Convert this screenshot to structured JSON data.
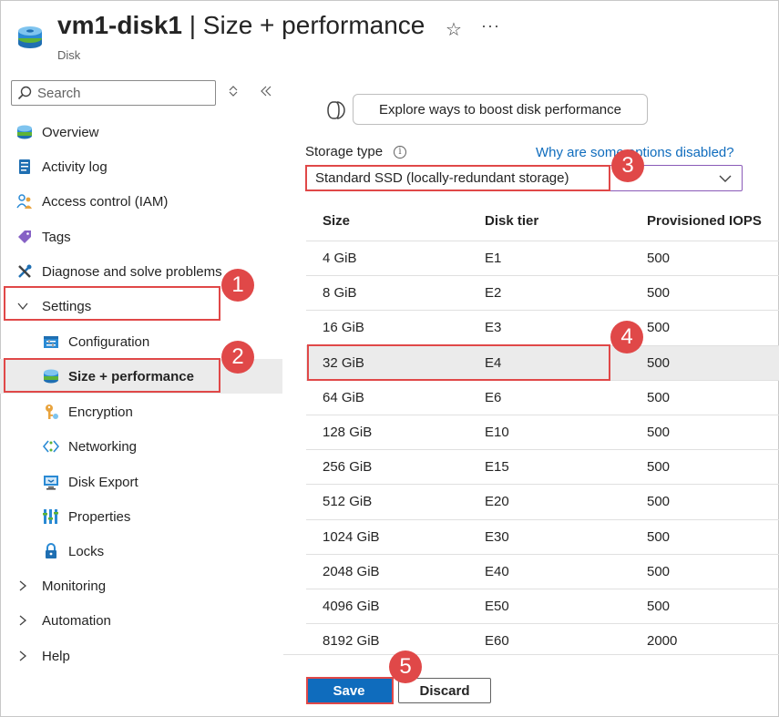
{
  "header": {
    "resource_name": "vm1-disk1",
    "page_title": " | Size + performance",
    "resource_type": "Disk",
    "star_glyph": "☆",
    "more_glyph": "···"
  },
  "sidebar": {
    "search_placeholder": "Search",
    "items": [
      {
        "label": "Overview",
        "icon": "disk-icon"
      },
      {
        "label": "Activity log",
        "icon": "activity-log-icon"
      },
      {
        "label": "Access control (IAM)",
        "icon": "people-icon"
      },
      {
        "label": "Tags",
        "icon": "tag-icon"
      },
      {
        "label": "Diagnose and solve problems",
        "icon": "wrench-icon"
      },
      {
        "label": "Settings",
        "icon": "chevron-down-icon",
        "expanded": true
      },
      {
        "label": "Configuration",
        "icon": "configuration-icon"
      },
      {
        "label": "Size + performance",
        "icon": "disk-icon",
        "active": true
      },
      {
        "label": "Encryption",
        "icon": "key-icon"
      },
      {
        "label": "Networking",
        "icon": "networking-icon"
      },
      {
        "label": "Disk Export",
        "icon": "export-icon"
      },
      {
        "label": "Properties",
        "icon": "properties-icon"
      },
      {
        "label": "Locks",
        "icon": "lock-icon"
      },
      {
        "label": "Monitoring",
        "icon": "chevron-right-icon"
      },
      {
        "label": "Automation",
        "icon": "chevron-right-icon"
      },
      {
        "label": "Help",
        "icon": "chevron-right-icon"
      }
    ]
  },
  "main": {
    "explore_button": "Explore ways to boost disk performance",
    "storage_type_label": "Storage type",
    "info_glyph": "i",
    "why_link": "Why are some options disabled?",
    "storage_type_value": "Standard SSD (locally-redundant storage)",
    "table": {
      "headers": [
        "Size",
        "Disk tier",
        "Provisioned IOPS"
      ],
      "rows": [
        [
          "4 GiB",
          "E1",
          "500"
        ],
        [
          "8 GiB",
          "E2",
          "500"
        ],
        [
          "16 GiB",
          "E3",
          "500"
        ],
        [
          "32 GiB",
          "E4",
          "500"
        ],
        [
          "64 GiB",
          "E6",
          "500"
        ],
        [
          "128 GiB",
          "E10",
          "500"
        ],
        [
          "256 GiB",
          "E15",
          "500"
        ],
        [
          "512 GiB",
          "E20",
          "500"
        ],
        [
          "1024 GiB",
          "E30",
          "500"
        ],
        [
          "2048 GiB",
          "E40",
          "500"
        ],
        [
          "4096 GiB",
          "E50",
          "500"
        ],
        [
          "8192 GiB",
          "E60",
          "2000"
        ]
      ],
      "selected_row": 3
    }
  },
  "footer": {
    "save_label": "Save",
    "discard_label": "Discard"
  },
  "callouts": [
    "1",
    "2",
    "3",
    "4",
    "5"
  ],
  "colors": {
    "accent": "#0f6cbd",
    "callout": "#e04848",
    "selected_row": "#ebebeb"
  }
}
